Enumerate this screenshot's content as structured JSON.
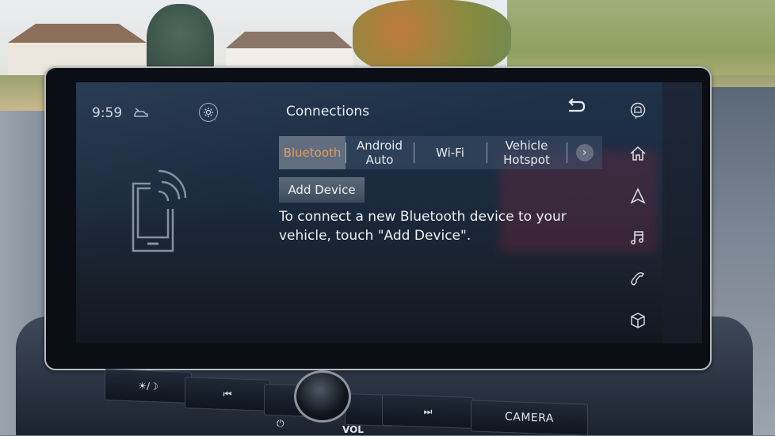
{
  "status_bar": {
    "time": "9:59",
    "vehicle_icon": "vehicle-status-icon",
    "settings_icon": "gear-icon"
  },
  "header": {
    "title": "Connections",
    "back_icon": "back-arrow-icon"
  },
  "tabs": [
    {
      "label_line1": "Bluetooth",
      "label_line2": "",
      "active": true
    },
    {
      "label_line1": "Android",
      "label_line2": "Auto",
      "active": false
    },
    {
      "label_line1": "Wi-Fi",
      "label_line2": "",
      "active": false
    },
    {
      "label_line1": "Vehicle",
      "label_line2": "Hotspot",
      "active": false
    }
  ],
  "tabs_more_glyph": "›",
  "main": {
    "add_device_label": "Add Device",
    "message": "To connect a new Bluetooth device to your vehicle, touch \"Add Device\".",
    "illustration": "bluetooth-phone-icon"
  },
  "rail": [
    {
      "name": "notification",
      "icon": "notification-bell-icon"
    },
    {
      "name": "home",
      "icon": "home-icon"
    },
    {
      "name": "navigation",
      "icon": "navigation-arrow-icon"
    },
    {
      "name": "audio",
      "icon": "music-note-icon"
    },
    {
      "name": "phone",
      "icon": "phone-icon"
    },
    {
      "name": "apps",
      "icon": "cube-icon"
    }
  ],
  "hardware_buttons": {
    "day_night_glyph": "☀/☽",
    "prev_glyph": "⏮",
    "next_glyph": "⏭",
    "camera_label": "CAMERA",
    "power_glyph": "⏻",
    "vol_label": "VOL"
  },
  "colors": {
    "active_tab_text": "#e59a55",
    "screen_text": "#eef1f3",
    "screen_bg": "#1a2a3f"
  }
}
